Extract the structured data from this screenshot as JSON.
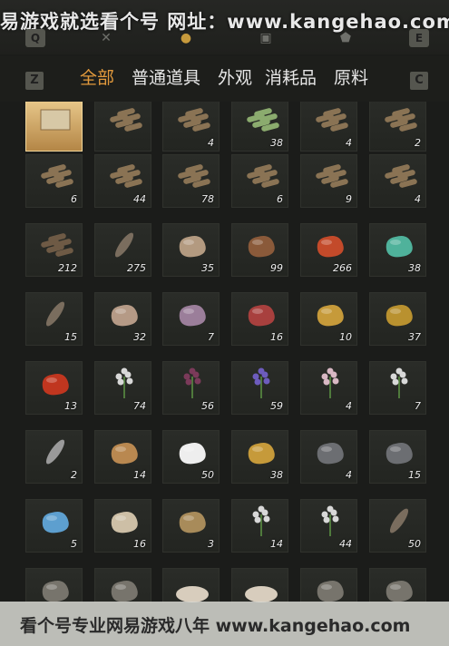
{
  "top_watermark": "易游戏就选看个号  网址：www.kangehao.com",
  "bottom_watermark": "看个号专业网易游戏八年 www.kangehao.com",
  "top_keys": [
    "Q",
    "E"
  ],
  "top_icons": [
    "close-icon",
    "pouch-icon",
    "chest-icon",
    "shield-icon"
  ],
  "tab_keys": [
    "Z",
    "C"
  ],
  "tabs": [
    "全部",
    "普通道具",
    "外观",
    "消耗品",
    "原料"
  ],
  "items": [
    {
      "icon": "scroll-icon",
      "qty": ""
    },
    {
      "icon": "log-bundle-icon",
      "qty": ""
    },
    {
      "icon": "log-bundle-icon",
      "qty": "4"
    },
    {
      "icon": "bamboo-bundle-icon",
      "qty": "38"
    },
    {
      "icon": "log-bundle-icon",
      "qty": "4"
    },
    {
      "icon": "log-bundle-icon",
      "qty": "2"
    },
    {
      "icon": "log-bundle-icon",
      "qty": "6"
    },
    {
      "icon": "log-bundle-icon",
      "qty": "44"
    },
    {
      "icon": "log-bundle-icon",
      "qty": "78"
    },
    {
      "icon": "log-bundle-icon",
      "qty": "6"
    },
    {
      "icon": "log-bundle-icon",
      "qty": "9"
    },
    {
      "icon": "log-bundle-icon",
      "qty": "4"
    },
    {
      "icon": "wood-pile-icon",
      "qty": "212"
    },
    {
      "icon": "feather-icon",
      "qty": "275"
    },
    {
      "icon": "mushroom-icon",
      "qty": "35"
    },
    {
      "icon": "shrimp-icon",
      "qty": "99"
    },
    {
      "icon": "berries-icon",
      "qty": "266"
    },
    {
      "icon": "jade-ore-icon",
      "qty": "38"
    },
    {
      "icon": "feathers-bundle-icon",
      "qty": "15"
    },
    {
      "icon": "hide-icon",
      "qty": "32"
    },
    {
      "icon": "root-icon",
      "qty": "7"
    },
    {
      "icon": "meat-icon",
      "qty": "16"
    },
    {
      "icon": "fish-icon",
      "qty": "10"
    },
    {
      "icon": "gold-ore-icon",
      "qty": "37"
    },
    {
      "icon": "amber-stone-icon",
      "qty": "13"
    },
    {
      "icon": "white-flower-icon",
      "qty": "74"
    },
    {
      "icon": "purple-petal-icon",
      "qty": "56"
    },
    {
      "icon": "lavender-icon",
      "qty": "59"
    },
    {
      "icon": "blossom-branch-icon",
      "qty": "4"
    },
    {
      "icon": "red-flower-icon",
      "qty": "7"
    },
    {
      "icon": "grass-sprig-icon",
      "qty": "2"
    },
    {
      "icon": "fur-icon",
      "qty": "14"
    },
    {
      "icon": "white-fleece-icon",
      "qty": "50"
    },
    {
      "icon": "pufferfish-icon",
      "qty": "38"
    },
    {
      "icon": "gray-ore-icon",
      "qty": "4"
    },
    {
      "icon": "dark-ore-icon",
      "qty": "15"
    },
    {
      "icon": "blue-crystal-icon",
      "qty": "5"
    },
    {
      "icon": "bone-icon",
      "qty": "16"
    },
    {
      "icon": "grain-sacks-icon",
      "qty": "3"
    },
    {
      "icon": "white-flower-plant-icon",
      "qty": "14"
    },
    {
      "icon": "pink-flower-plant-icon",
      "qty": "44"
    },
    {
      "icon": "dark-feather-icon",
      "qty": "50"
    },
    {
      "icon": "partial-item-icon",
      "qty": ""
    },
    {
      "icon": "partial-item-icon",
      "qty": ""
    },
    {
      "icon": "bowl-icon",
      "qty": ""
    },
    {
      "icon": "bowl-icon",
      "qty": ""
    },
    {
      "icon": "partial-item-icon",
      "qty": ""
    },
    {
      "icon": "partial-item-icon",
      "qty": ""
    }
  ]
}
